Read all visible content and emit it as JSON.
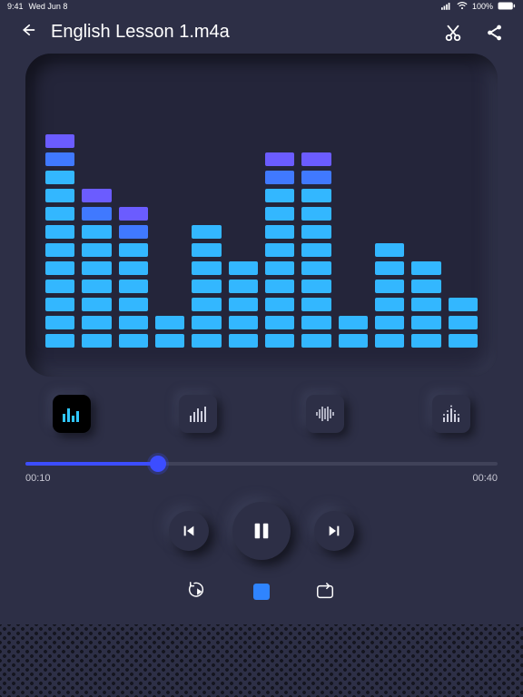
{
  "status": {
    "time": "9:41",
    "date": "Wed Jun 8",
    "battery": "100%"
  },
  "header": {
    "title": "English Lesson 1.m4a"
  },
  "visualizer": {
    "max": 14,
    "levels": [
      12,
      9,
      8,
      2,
      7,
      5,
      11,
      11,
      2,
      6,
      5,
      3
    ],
    "topColor": "#6b5cff",
    "midColor": "#4079ff",
    "baseColor": "#33b7ff"
  },
  "slider": {
    "elapsed": "00:10",
    "total": "00:40",
    "percent": 28
  },
  "vistypes": {
    "active": 0
  }
}
